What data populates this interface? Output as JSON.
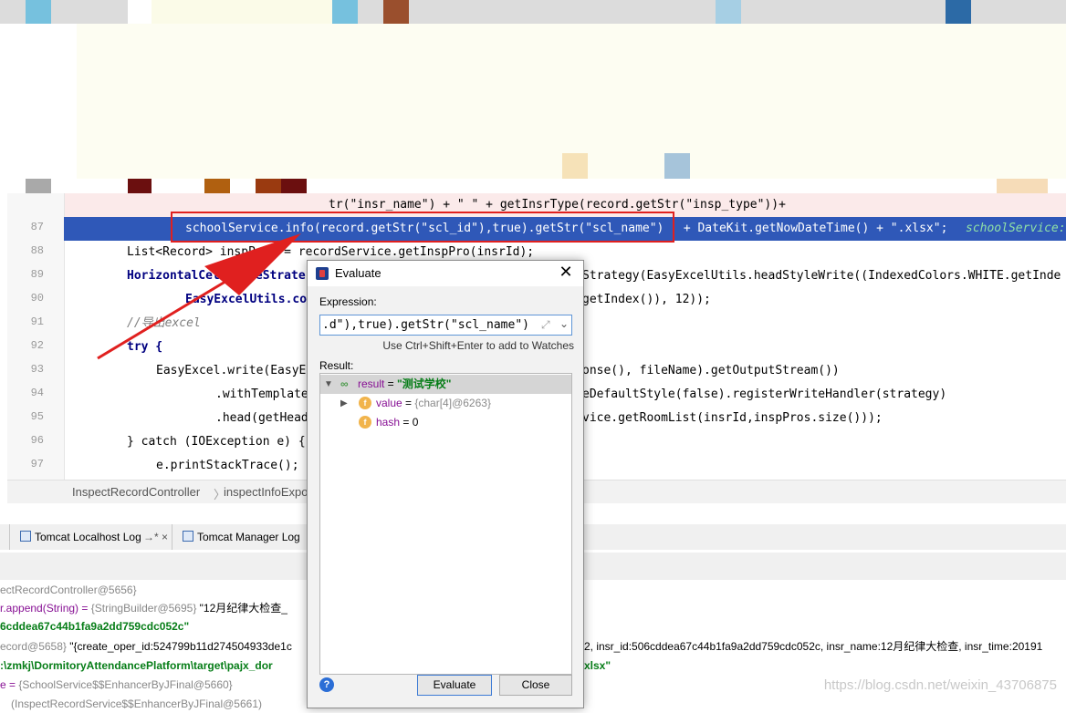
{
  "editor": {
    "line_numbers": [
      "87",
      "88",
      "89",
      "90",
      "91",
      "92",
      "93",
      "94",
      "95",
      "96",
      "97"
    ],
    "line_86_partial": "tr(\"insr_name\") + \" \" + getInsrType(record.getStr(\"insp_type\"))+",
    "line_87": {
      "boxed": "schoolService.info(record.getStr(\"scl_id\"),true).getStr(\"scl_name\")",
      "rest": " + DateKit.getNowDateTime() + \".xlsx\";",
      "hint": "schoolService:"
    },
    "line_88": "List<Record> inspPros = recordService.getInspPro(insrId);",
    "line_89a": "HorizontalCellStyleStrate",
    "line_89b": "Strategy(EasyExcelUtils.headStyleWrite((IndexedColors.WHITE.getInde",
    "line_90a": "EasyExcelUtils.co",
    "line_90b": "getIndex()), 12));",
    "line_91": "//导出excel",
    "line_92": "try {",
    "line_93a": "EasyExcel.write(EasyE",
    "line_93b": "onse(), fileName).getOutputStream())",
    "line_94a": ".withTemplate",
    "line_94b": "eDefaultStyle(false).registerWriteHandler(strategy)",
    "line_95a": ".head(getHead",
    "line_95b": "vice.getRoomList(insrId,inspPros.size()));",
    "line_96": "} catch (IOException e) {",
    "line_97": "e.printStackTrace();"
  },
  "breadcrumb": {
    "item1": "InspectRecordController",
    "sep": "〉",
    "item2": "inspectInfoExpo"
  },
  "tabs": {
    "localhost_log": "Tomcat Localhost Log",
    "localhost_extra": "→* ×",
    "manager_log": "Tomcat Manager Log"
  },
  "variables": {
    "row1": "ectRecordController@5656}",
    "row2_name": "r.append(String) = ",
    "row2_type": "{StringBuilder@5695}",
    "row2_val": " \"12月纪律大检查_",
    "row3": "6cddea67c44b1fa9a2dd759cdc052c\"",
    "row4a": "ecord@5658}",
    "row4b": " \"{create_oper_id:524799b11d274504933de1c",
    "row4c": "2, insr_id:506cddea67c44b1fa9a2dd759cdc052c, insr_name:12月纪律大检查, insr_time:20191",
    "row5a": ":\\zmkj\\DormitoryAttendancePlatform\\target\\pajx_dor",
    "row5b": "xlsx\"",
    "row6_name": "e = ",
    "row6_type": "{SchoolService$$EnhancerByJFinal@5660}",
    "row7": "(InspectRecordService$$EnhancerByJFinal@5661)"
  },
  "watermark": "https://blog.csdn.net/weixin_43706875",
  "dialog": {
    "title": "Evaluate",
    "close": "✕",
    "expression_label": "Expression:",
    "expression_value": ".d\"),true).getStr(\"scl_name\")",
    "expand_icon": "⤢",
    "dropdown_icon": "⌄",
    "hint": "Use Ctrl+Shift+Enter to add to Watches",
    "result_label": "Result:",
    "tree": {
      "result_name": "result",
      "result_eq": " = ",
      "result_value": "\"测试学校\"",
      "value_name": "value",
      "value_eq": " = ",
      "value_type": "{char[4]@6263}",
      "hash_name": "hash",
      "hash_eq": " = ",
      "hash_value": "0"
    },
    "help": "?",
    "evaluate_button": "Evaluate",
    "close_button": "Close"
  },
  "colors": {
    "exec_line": "#2f58b8",
    "highlight_box": "#e0201f",
    "annotation_arrow": "#e0201f"
  }
}
